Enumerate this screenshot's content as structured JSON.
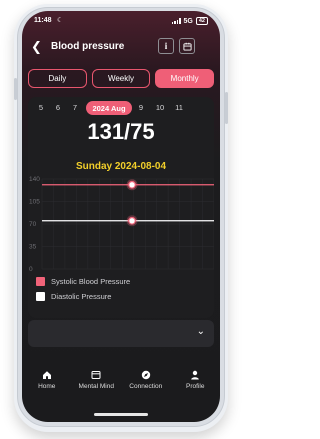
{
  "status_bar": {
    "time": "11:48",
    "network": "5G",
    "battery": "42"
  },
  "header": {
    "title": "Blood pressure",
    "info_label": "i"
  },
  "tabs": [
    {
      "label": "Daily",
      "active": false
    },
    {
      "label": "Weekly",
      "active": false
    },
    {
      "label": "Monthly",
      "active": true
    }
  ],
  "dates": [
    "5",
    "6",
    "7",
    "2024 Aug",
    "9",
    "10",
    "11"
  ],
  "reading": {
    "value": "131/75",
    "date": "Sunday 2024-08-04"
  },
  "chart_data": {
    "type": "line",
    "y_ticks": [
      "140",
      "105",
      "70",
      "35",
      "0"
    ],
    "ylim": [
      0,
      140
    ],
    "series": [
      {
        "name": "Systolic Blood Pressure",
        "color": "#f16379",
        "value": 131
      },
      {
        "name": "Diastolic Pressure",
        "color": "#ffffff",
        "value": 75
      }
    ]
  },
  "legend": [
    {
      "label": "Systolic Blood Pressure",
      "color": "#f16379"
    },
    {
      "label": "Diastolic Pressure",
      "color": "#ffffff"
    }
  ],
  "nav": [
    {
      "label": "Home",
      "icon": "home-icon"
    },
    {
      "label": "Mental Mind",
      "icon": "mental-mind-icon"
    },
    {
      "label": "Connection",
      "icon": "compass-icon"
    },
    {
      "label": "Profile",
      "icon": "profile-icon"
    }
  ],
  "colors": {
    "accent": "#ef5f77",
    "date_highlight": "#f2cf2a",
    "background": "#1c1c1e"
  }
}
